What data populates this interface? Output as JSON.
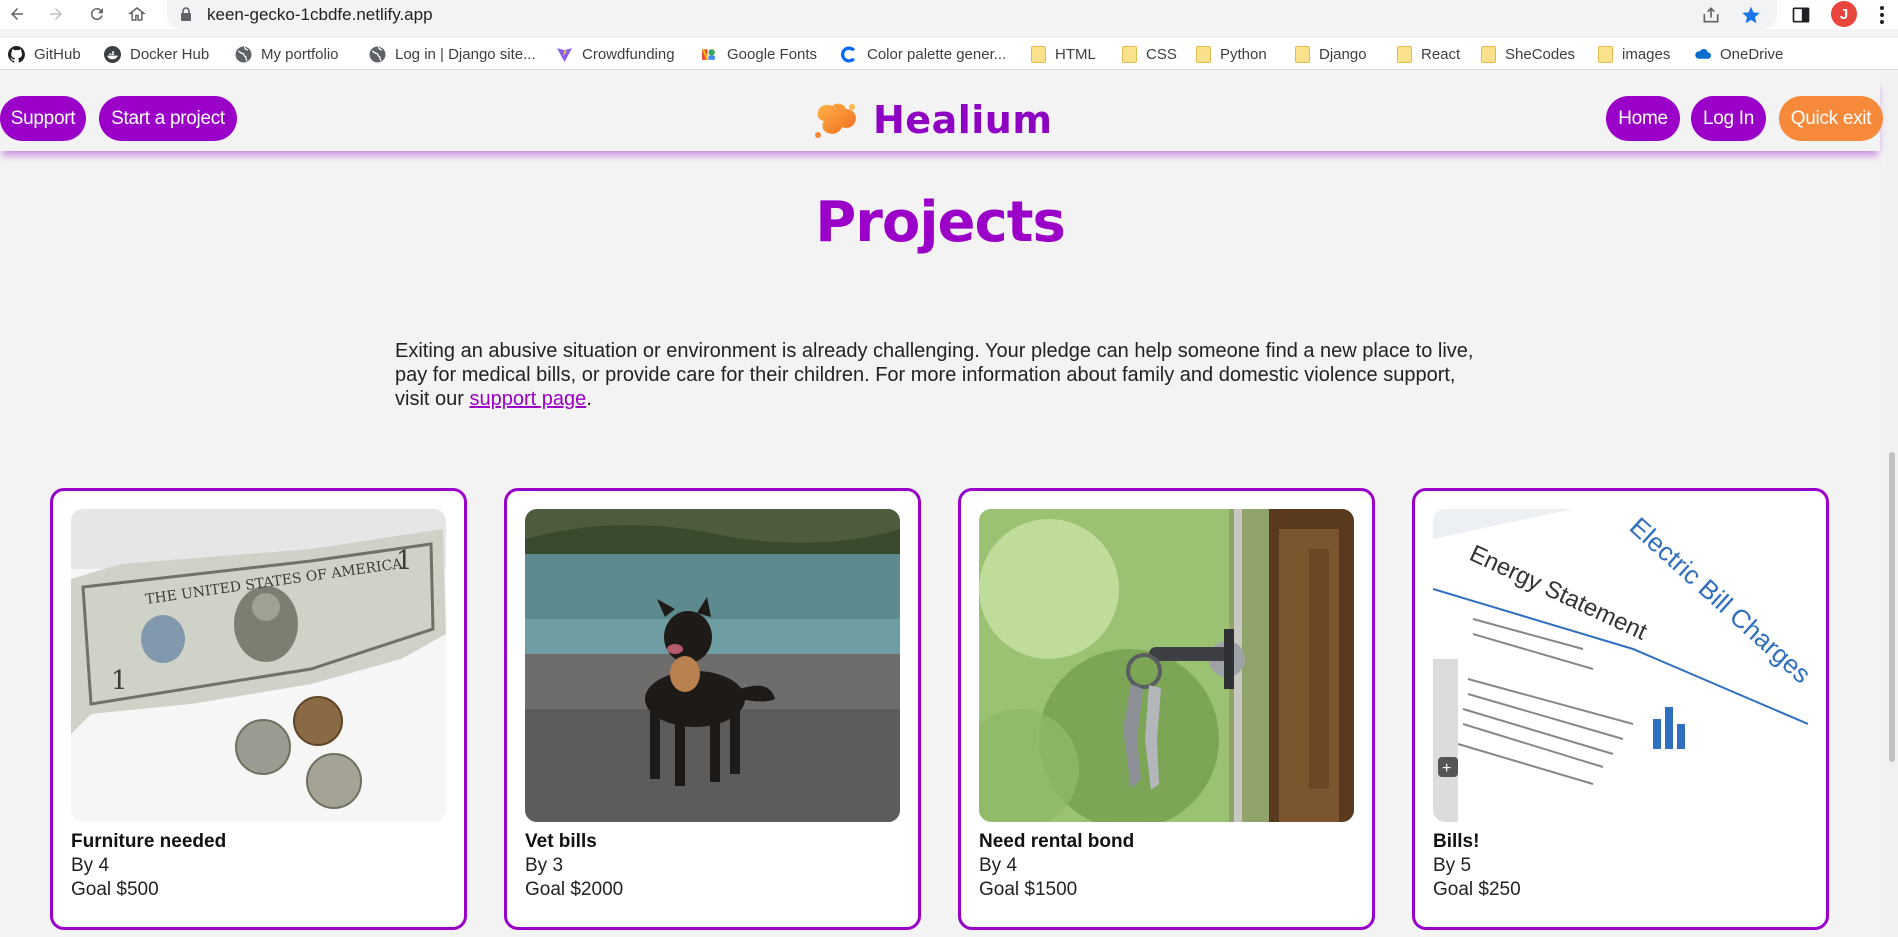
{
  "browser": {
    "url": "keen-gecko-1cbdfe.netlify.app",
    "profile_initial": "J",
    "bookmarks": [
      {
        "label": "GitHub",
        "icon": "github-icon"
      },
      {
        "label": "Docker Hub",
        "icon": "docker-icon"
      },
      {
        "label": "My portfolio",
        "icon": "globe-icon"
      },
      {
        "label": "Log in | Django site...",
        "icon": "globe-icon"
      },
      {
        "label": "Crowdfunding",
        "icon": "vite-icon"
      },
      {
        "label": "Google Fonts",
        "icon": "google-fonts-icon"
      },
      {
        "label": "Color palette gener...",
        "icon": "coolors-icon"
      },
      {
        "label": "HTML",
        "icon": "folder-icon"
      },
      {
        "label": "CSS",
        "icon": "folder-icon"
      },
      {
        "label": "Python",
        "icon": "folder-icon"
      },
      {
        "label": "Django",
        "icon": "folder-icon"
      },
      {
        "label": "React",
        "icon": "folder-icon"
      },
      {
        "label": "SheCodes",
        "icon": "folder-icon"
      },
      {
        "label": "images",
        "icon": "folder-icon"
      },
      {
        "label": "OneDrive",
        "icon": "onedrive-icon"
      }
    ]
  },
  "header": {
    "support_label": "Support",
    "start_project_label": "Start a project",
    "logo_text": "Healium",
    "home_label": "Home",
    "login_label": "Log In",
    "quick_exit_label": "Quick exit"
  },
  "colors": {
    "brand_purple": "#9a00c8",
    "accent_orange": "#f7893b",
    "page_background": "#f4f3f4"
  },
  "main": {
    "title": "Projects",
    "intro_text": "Exiting an abusive situation or environment is already challenging. Your pledge can help someone find a new place to live, pay for medical bills, or provide care for their children. For more information about family and domestic violence support, visit our ",
    "intro_link": "support page",
    "intro_end": "."
  },
  "projects": [
    {
      "title": "Furniture needed",
      "by": "By 4",
      "goal": "Goal $500",
      "image": "dollar-bill-and-coins"
    },
    {
      "title": "Vet bills",
      "by": "By 3",
      "goal": "Goal $2000",
      "image": "dog-on-beach"
    },
    {
      "title": "Need rental bond",
      "by": "By 4",
      "goal": "Goal $1500",
      "image": "keys-in-door"
    },
    {
      "title": "Bills!",
      "by": "By 5",
      "goal": "Goal $250",
      "image": "electric-bill-statement"
    }
  ]
}
